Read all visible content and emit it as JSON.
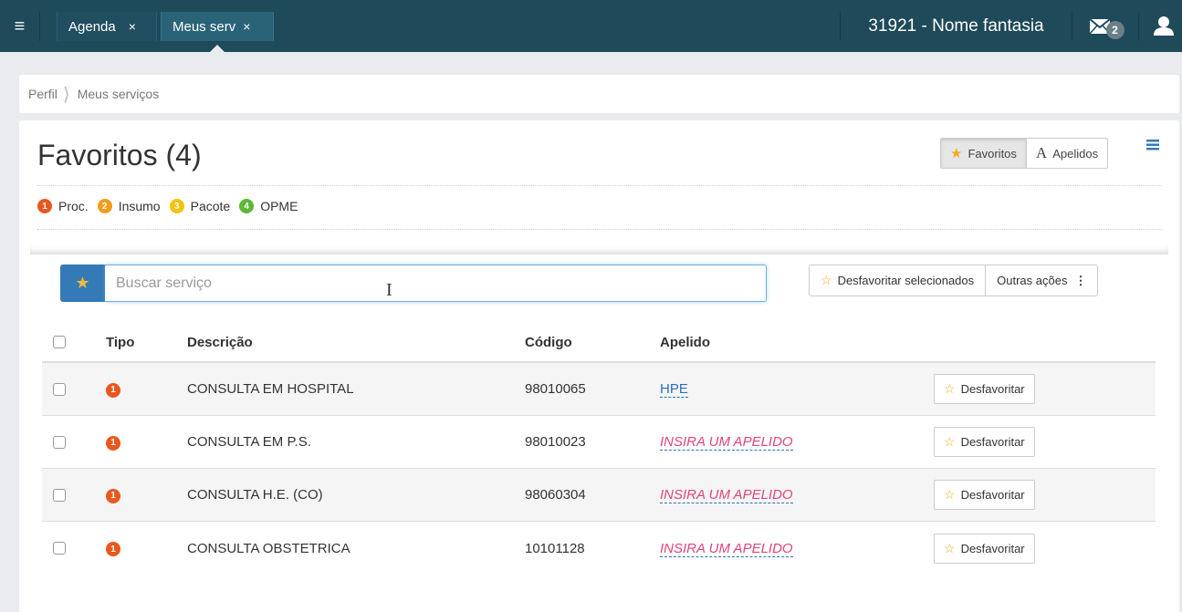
{
  "topbar": {
    "menu_icon": "hamburger-icon",
    "tabs": [
      {
        "label": "Agenda",
        "close": "×"
      },
      {
        "label": "Meus serv",
        "close": "×"
      }
    ],
    "clinic_name": "31921 - Nome fantasia",
    "mail_badge": "2"
  },
  "breadcrumb": {
    "items": [
      "Perfil",
      "Meus serviços"
    ]
  },
  "page": {
    "title": "Favoritos (4)",
    "view_options": [
      "Favoritos",
      "Apelidos"
    ],
    "active_view": "Favoritos"
  },
  "legend": [
    {
      "num": "1",
      "label": "Proc.",
      "color": "#e8581c"
    },
    {
      "num": "2",
      "label": "Insumo",
      "color": "#f39c1c"
    },
    {
      "num": "3",
      "label": "Pacote",
      "color": "#f4c20d"
    },
    {
      "num": "4",
      "label": "OPME",
      "color": "#5cb836"
    }
  ],
  "search": {
    "placeholder": "Buscar serviço",
    "value": ""
  },
  "actions": {
    "unfavorite_selected": "Desfavoritar selecionados",
    "other_actions": "Outras ações"
  },
  "table": {
    "headers": {
      "tipo": "Tipo",
      "descricao": "Descrição",
      "codigo": "Código",
      "apelido": "Apelido"
    },
    "rows": [
      {
        "tipo": "1",
        "descricao": "CONSULTA EM HOSPITAL",
        "codigo": "98010065",
        "apelido": "HPE",
        "has_alias": true,
        "action": "Desfavoritar"
      },
      {
        "tipo": "1",
        "descricao": "CONSULTA EM P.S.",
        "codigo": "98010023",
        "apelido": "INSIRA UM APELIDO",
        "has_alias": false,
        "action": "Desfavoritar"
      },
      {
        "tipo": "1",
        "descricao": "CONSULTA H.E. (CO)",
        "codigo": "98060304",
        "apelido": "INSIRA UM APELIDO",
        "has_alias": false,
        "action": "Desfavoritar"
      },
      {
        "tipo": "1",
        "descricao": "CONSULTA OBSTETRICA",
        "codigo": "10101128",
        "apelido": "INSIRA UM APELIDO",
        "has_alias": false,
        "action": "Desfavoritar"
      }
    ]
  },
  "colors": {
    "topbar": "#1f4a5a",
    "primary": "#337ab7",
    "star": "#f0ad1f",
    "alias_link": "#2a6fbf",
    "alias_empty": "#e0457b",
    "tipo_proc": "#e8581c"
  }
}
